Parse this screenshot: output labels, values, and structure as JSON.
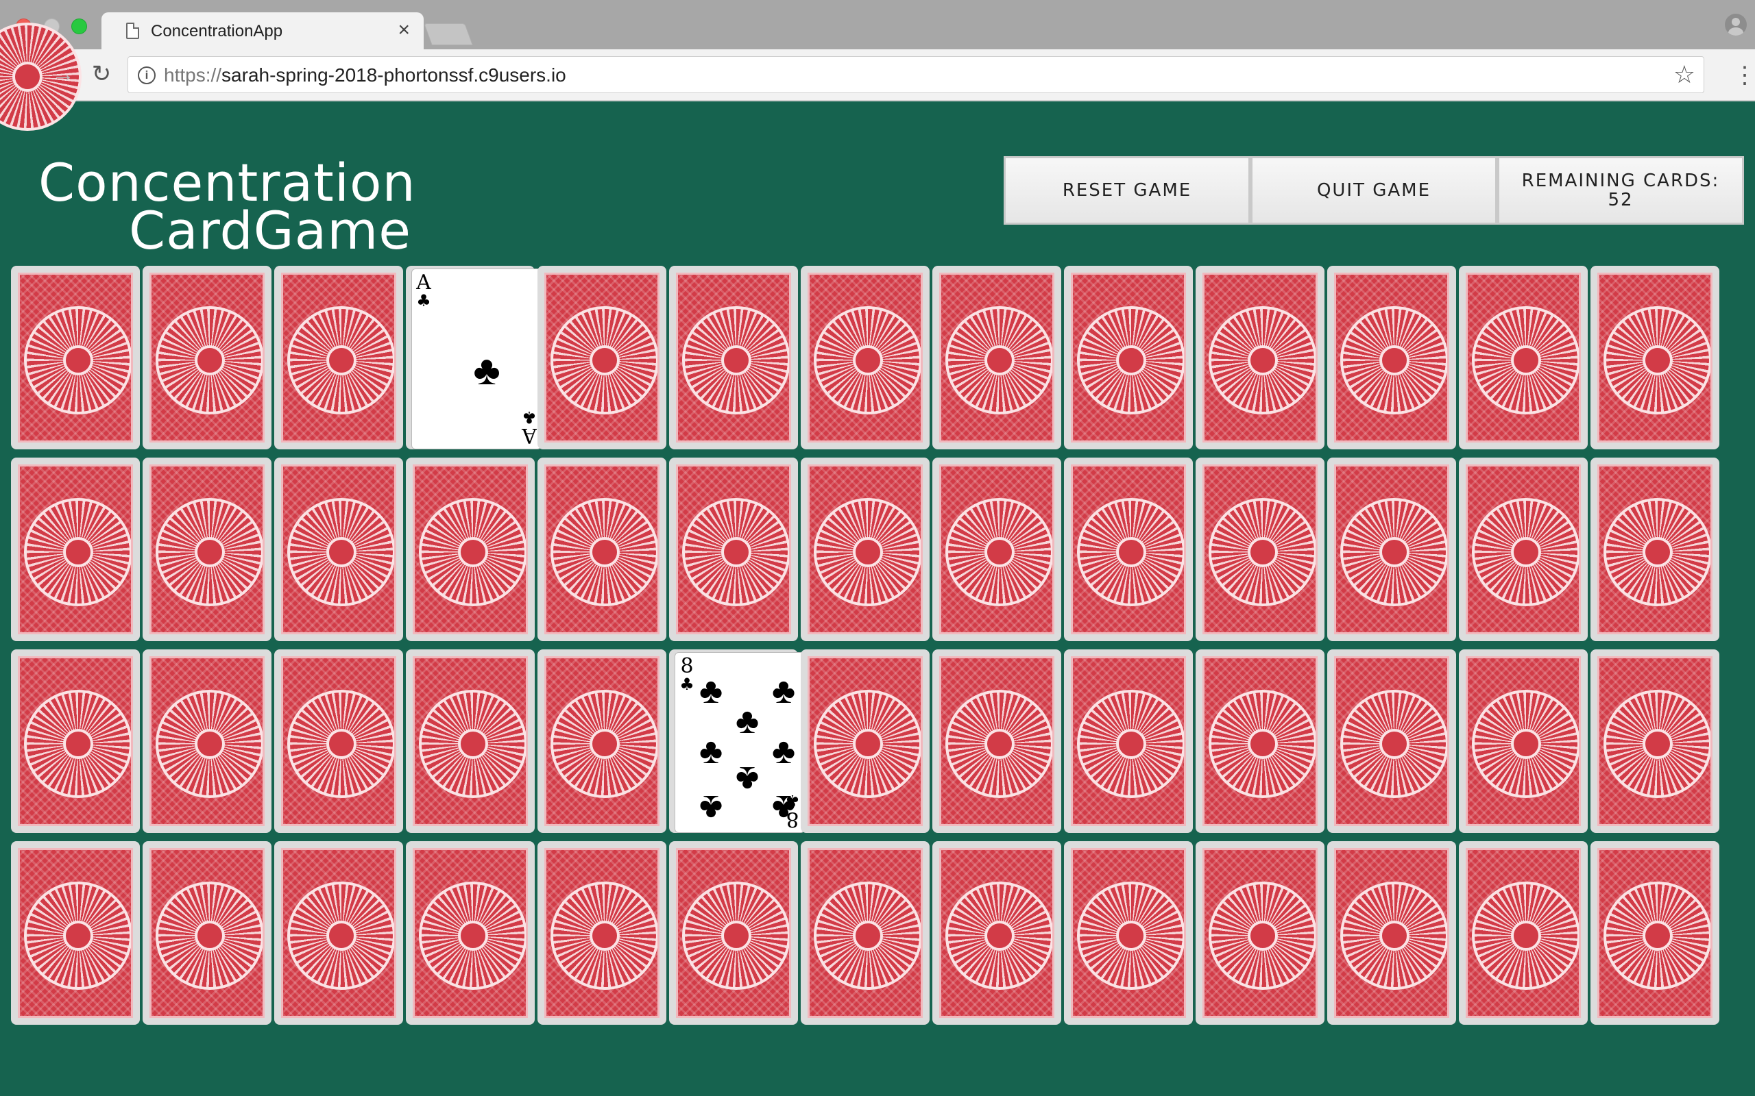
{
  "browser": {
    "tab_title": "ConcentrationApp",
    "tab_close": "×",
    "url_scheme": "https://",
    "url_host": "sarah-spring-2018-phortonssf.c9users.io",
    "icons": [
      "back-arrow-icon",
      "forward-arrow-icon",
      "reload-icon",
      "info-icon",
      "star-icon",
      "menu-dots-icon",
      "profile-icon",
      "document-icon"
    ]
  },
  "app": {
    "title_line1": "Concentration",
    "title_line2": "CardGame",
    "reset_label": "RESET GAME",
    "quit_label": "QUIT GAME",
    "remaining_label": "REMAINING CARDS:",
    "remaining_count": "52"
  },
  "board": {
    "rows": 4,
    "columns": 13,
    "card_back_color": "#d23b47",
    "table_color": "#16634f",
    "face_up": [
      {
        "row": 1,
        "col": 4,
        "rank": "A",
        "suit": "♣"
      },
      {
        "row": 3,
        "col": 6,
        "rank": "8",
        "suit": "♣"
      }
    ]
  }
}
